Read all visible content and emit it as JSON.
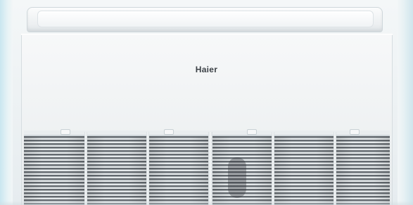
{
  "unit": {
    "brand_label": "Haier",
    "colors": {
      "body": "#eef1f2",
      "grille_dark": "#5a6066",
      "edge_tint": "#c9e6f0",
      "brand_text": "#3c4146"
    },
    "grille_sections": 6
  }
}
